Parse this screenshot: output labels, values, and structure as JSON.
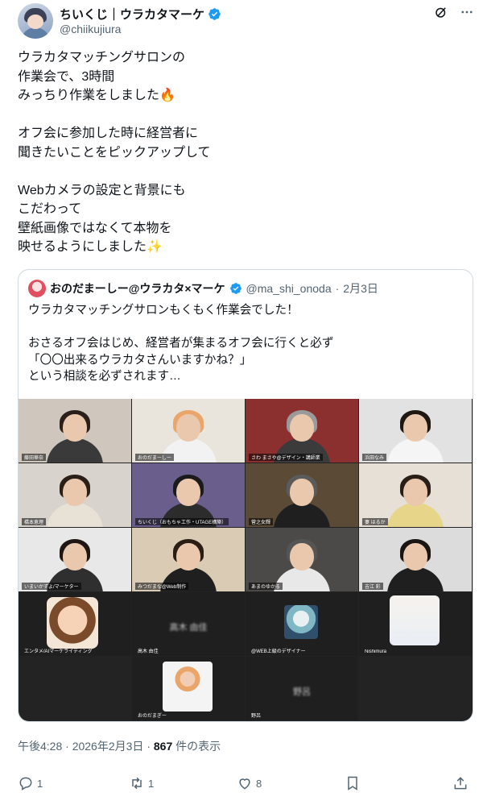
{
  "header": {
    "display_name": "ちいくじ｜ウラカタマーケ",
    "handle": "@chiikujiura",
    "grok_icon": "grok-icon",
    "more_icon": "more-icon"
  },
  "tweet": {
    "text": "ウラカタマッチングサロンの\n作業会で、3時間\nみっちり作業をしました🔥\n\nオフ会に参加した時に経営者に\n聞きたいことをピックアップして\n\nWebカメラの設定と背景にも\nこだわって\n壁紙画像ではなくて本物を\n映せるようにしました✨"
  },
  "quote": {
    "name": "おのだまーしー@ウラカタ×マーケ",
    "handle": "@ma_shi_onoda",
    "separator": "·",
    "date": "2月3日",
    "text": "ウラカタマッチングサロンもくもく作業会でした！\n\nおさるオフ会はじめ、経営者が集まるオフ会に行くと必ず\n「〇〇出来るウラカタさんいますかね？」\nという相談を必ずされます…",
    "tiles": [
      {
        "name": "藤田華奈",
        "bg": "#cfc7bd",
        "hair": "#2a1f1a",
        "shirt": "#3a3a3a"
      },
      {
        "name": "おのだまーしー",
        "bg": "#e9e4dc",
        "hair": "#e9a56a",
        "shirt": "#f2f2f2"
      },
      {
        "name": "さわ まさや@デザイン・講師業",
        "bg": "#8c2f2f",
        "hair": "#9a9a9a",
        "shirt": "#3b3b3b"
      },
      {
        "name": "浜田なみ",
        "bg": "#e2e2e2",
        "hair": "#1e1712",
        "shirt": "#f5f5f5"
      },
      {
        "name": "橋本恵理",
        "bg": "#d8d3cc",
        "hair": "#2b2018",
        "shirt": "#e8e1d6"
      },
      {
        "name": "ちいくじ（おもちゃ工作・UTAGE構築）",
        "bg": "#6a5f8c",
        "hair": "#1b1b1b",
        "shirt": "#2c2c2c"
      },
      {
        "name": "菅之女輝",
        "bg": "#5a4a36",
        "hair": "#5b5b5b",
        "shirt": "#1f1f1f"
      },
      {
        "name": "妻 はるか",
        "bg": "#e6e0d6",
        "hair": "#2a1e16",
        "shirt": "#e7d68a"
      },
      {
        "name": "いまいかずよ/マーケター",
        "bg": "#e8e8e8",
        "hair": "#1d1612",
        "shirt": "#2f2f2f"
      },
      {
        "name": "みつだまな@Web制作",
        "bg": "#d9cbb4",
        "hair": "#2a1d14",
        "shirt": "#1f1f1f"
      },
      {
        "name": "あまのゆかる",
        "bg": "#4c4a48",
        "hair": "#555",
        "shirt": "#e8e8e8"
      },
      {
        "name": "吉江 彩",
        "bg": "#dcdcdc",
        "hair": "#1a1412",
        "shirt": "#1f1f1f"
      }
    ],
    "row4": [
      {
        "name": "エンタメ/AIマーケライティング",
        "kind": "illus"
      },
      {
        "name": "高木 由佳",
        "kind": "blank",
        "blurred": "高木 由佳"
      },
      {
        "name": "@WEB上級のデザイナー",
        "kind": "tealavatar"
      },
      {
        "name": "Nishimura",
        "kind": "sketch"
      }
    ],
    "row5": [
      {
        "name": "おのだまぎー",
        "kind": "photo"
      },
      {
        "name": "野呂",
        "kind": "blank",
        "blurred": "野呂"
      }
    ]
  },
  "meta": {
    "time": "午後4:28",
    "sep1": "·",
    "date": "2026年2月3日",
    "sep2": "·",
    "views": "867",
    "views_label": " 件の表示"
  },
  "actions": {
    "reply_count": "1",
    "retweet_count": "1",
    "like_count": "8"
  }
}
